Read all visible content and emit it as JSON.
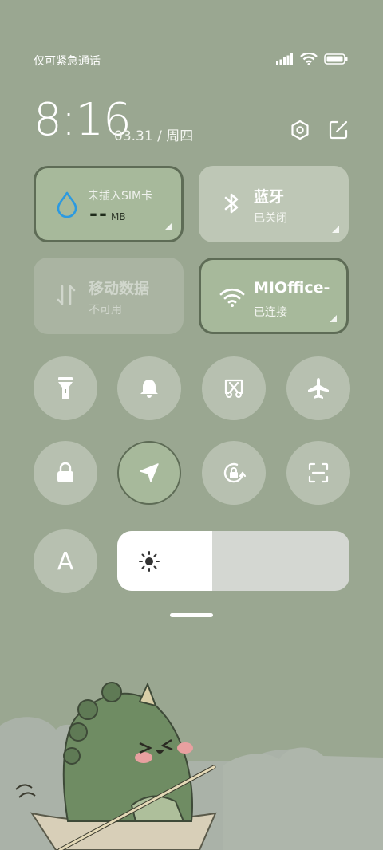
{
  "status": {
    "carrier_text": "仅可紧急通话",
    "icons": [
      "signal-icon",
      "wifi-icon",
      "battery-icon"
    ]
  },
  "header": {
    "time": "8:16",
    "date": "03.31 / 周四",
    "icons": [
      "settings-icon",
      "edit-icon"
    ]
  },
  "tiles": {
    "sim": {
      "title": "未插入SIM卡",
      "value": "--",
      "unit": "MB",
      "icon": "water-drop-icon",
      "accent": "#2c9ae0"
    },
    "bluetooth": {
      "title": "蓝牙",
      "subtitle": "已关闭",
      "icon": "bluetooth-icon"
    },
    "mobile_data": {
      "title": "移动数据",
      "subtitle": "不可用",
      "icon": "data-arrows-icon"
    },
    "wifi": {
      "title": "MIOffice-",
      "subtitle": "已连接",
      "icon": "wifi-icon"
    }
  },
  "toggles_row1": [
    "flashlight-icon",
    "bell-icon",
    "screenshot-icon",
    "airplane-icon"
  ],
  "toggles_row2": [
    "lock-icon",
    "location-icon",
    "rotation-lock-icon",
    "scan-icon"
  ],
  "font_button": {
    "label": "A"
  },
  "brightness": {
    "level": 0.41,
    "icon": "sun-icon"
  },
  "colors": {
    "background": "#9aa791",
    "active_tile": "#a7b99b",
    "active_border": "#5e6c56"
  }
}
